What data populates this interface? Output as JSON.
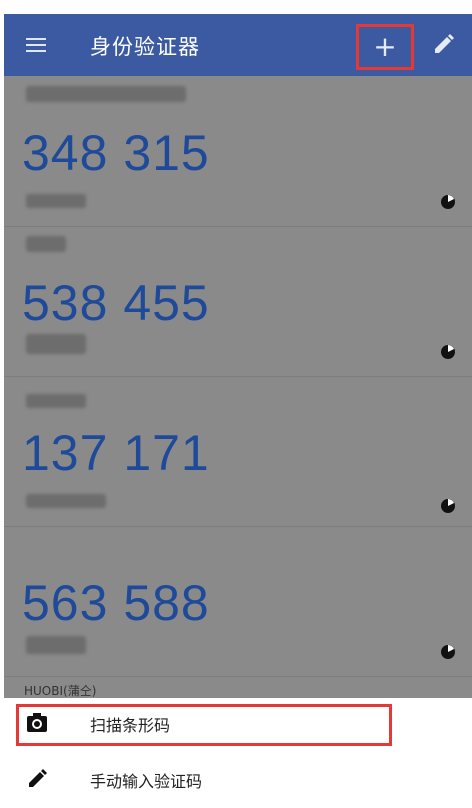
{
  "appbar": {
    "title": "身份验证器",
    "menu_icon": "hamburger-menu-icon",
    "add_label": "+",
    "edit_icon": "pencil-icon",
    "highlight_color": "#e53935",
    "background": "#3b5aa1"
  },
  "entries": [
    {
      "code": "348 315"
    },
    {
      "code": "538 455"
    },
    {
      "code": "137 171"
    },
    {
      "code": "563 588"
    }
  ],
  "partial_label": "HUOBI(蒲仝)",
  "sheet": {
    "options": [
      {
        "label": "扫描条形码",
        "icon": "camera-icon"
      },
      {
        "label": "手动输入验证码",
        "icon": "pencil-icon"
      }
    ]
  },
  "colors": {
    "code_color": "#1f4a99",
    "overlay": "#8a8a8a"
  }
}
